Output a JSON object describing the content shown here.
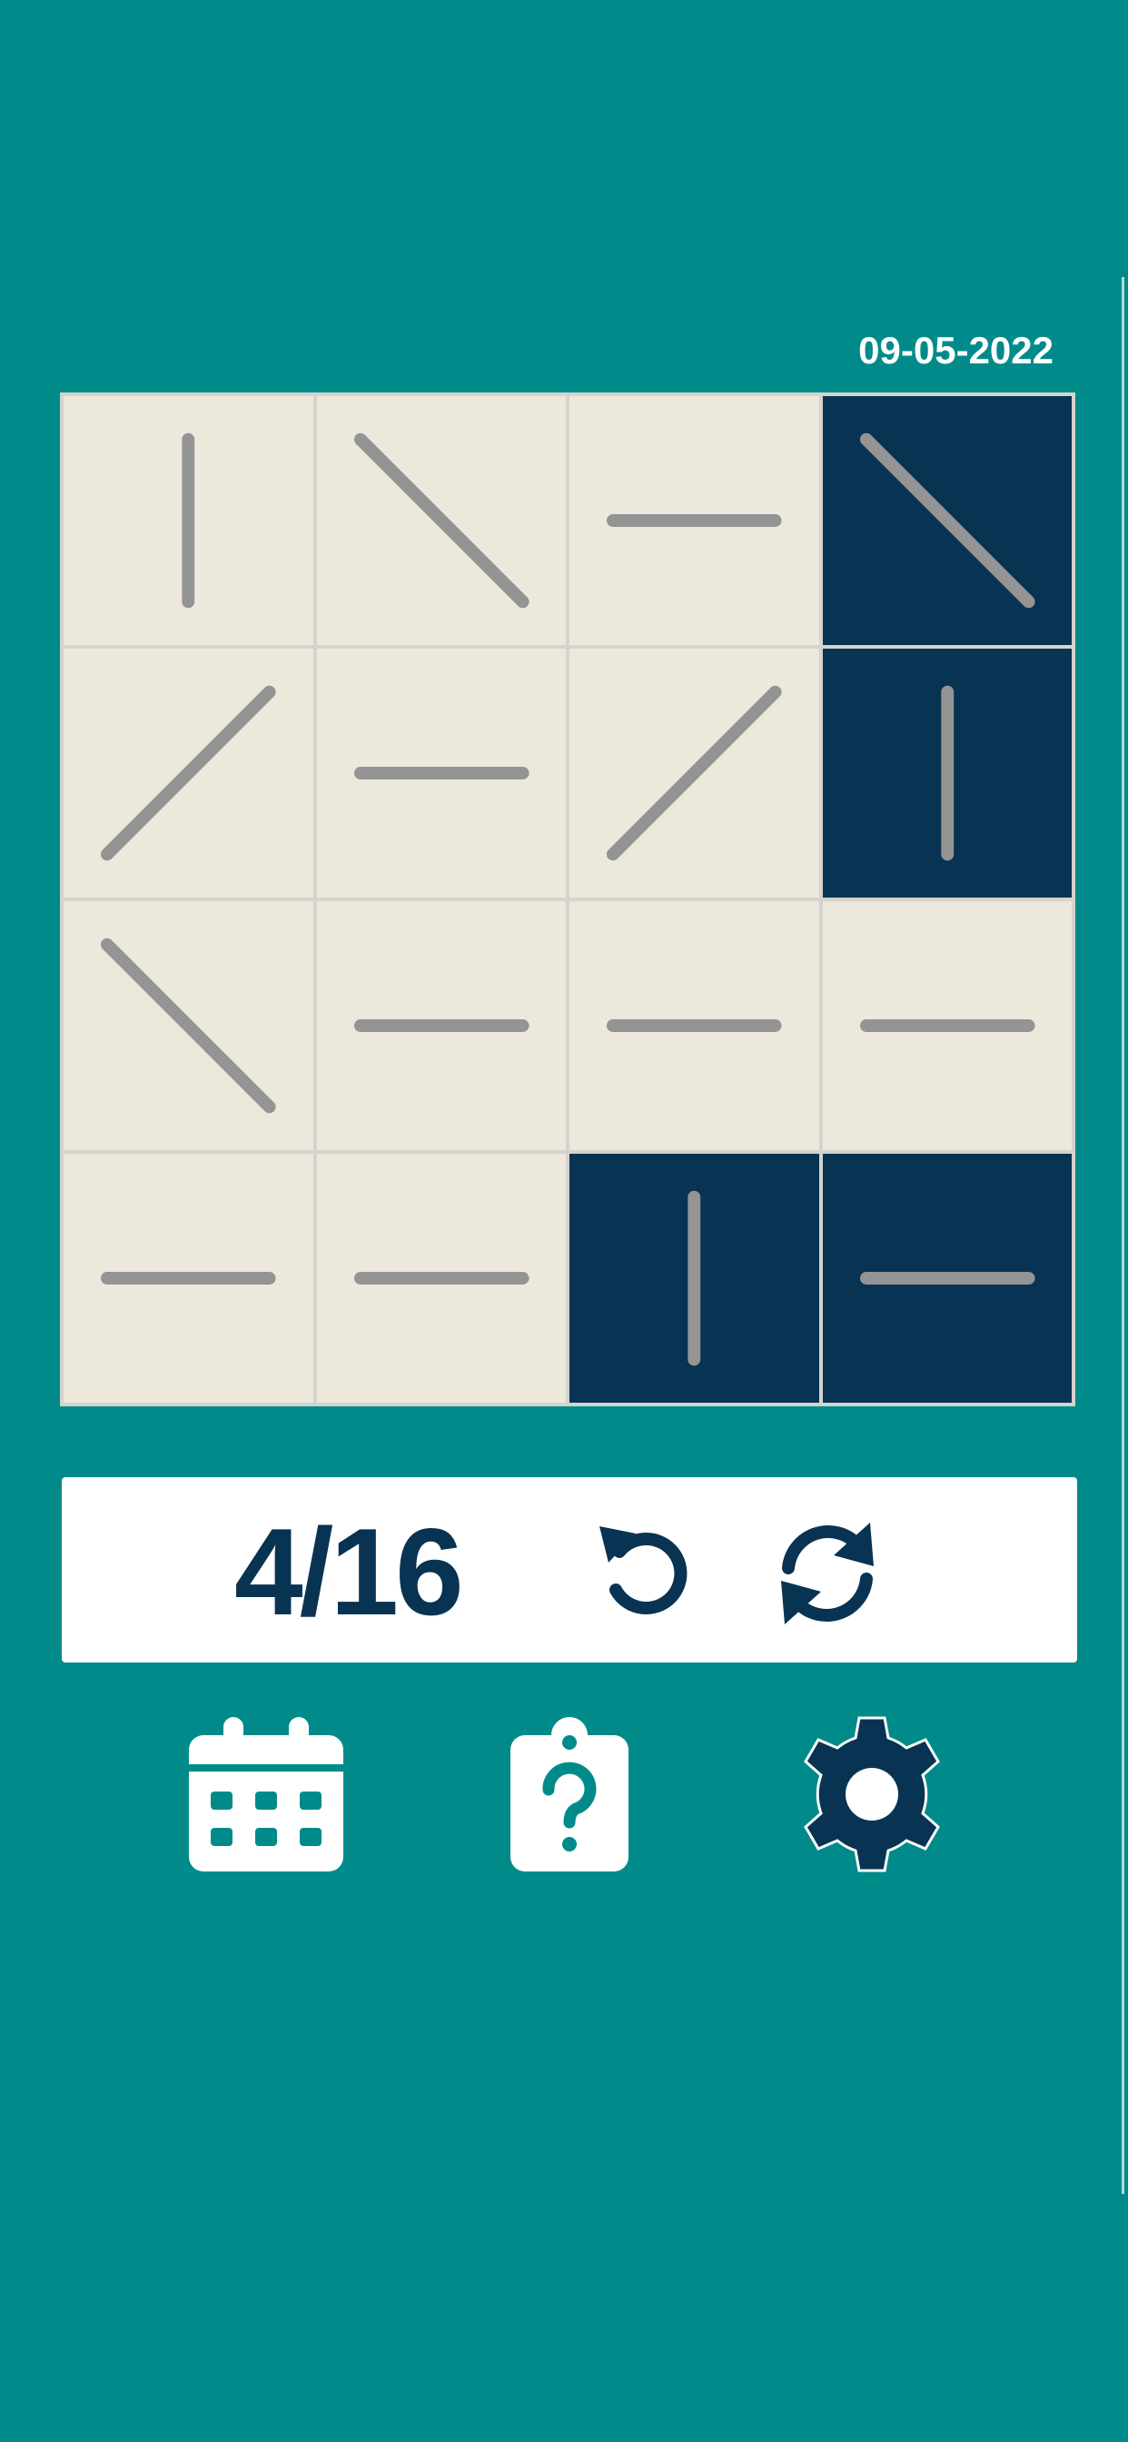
{
  "header": {
    "date": "09-05-2022"
  },
  "board": {
    "rows": 4,
    "cols": 4,
    "tiles": [
      {
        "line": "vertical",
        "state": "light"
      },
      {
        "line": "diagonal-down",
        "state": "light"
      },
      {
        "line": "horizontal",
        "state": "light"
      },
      {
        "line": "diagonal-down",
        "state": "dark"
      },
      {
        "line": "diagonal-up",
        "state": "light"
      },
      {
        "line": "horizontal",
        "state": "light"
      },
      {
        "line": "diagonal-up",
        "state": "light"
      },
      {
        "line": "vertical",
        "state": "dark"
      },
      {
        "line": "diagonal-down",
        "state": "light"
      },
      {
        "line": "horizontal",
        "state": "light"
      },
      {
        "line": "horizontal",
        "state": "light"
      },
      {
        "line": "horizontal",
        "state": "light"
      },
      {
        "line": "horizontal",
        "state": "light"
      },
      {
        "line": "horizontal",
        "state": "light"
      },
      {
        "line": "vertical",
        "state": "dark"
      },
      {
        "line": "horizontal",
        "state": "dark"
      }
    ]
  },
  "status": {
    "score": "4/16",
    "undo_icon": "undo-icon",
    "restart_icon": "restart-icon"
  },
  "toolbar": {
    "calendar_icon": "calendar-icon",
    "help_icon": "help-clipboard-icon",
    "settings_icon": "gear-icon"
  },
  "colors": {
    "background": "#008b8a",
    "tile_light": "#ece8dc",
    "tile_dark": "#093352",
    "line": "#949494",
    "accent_dark": "#093352",
    "white": "#ffffff"
  }
}
